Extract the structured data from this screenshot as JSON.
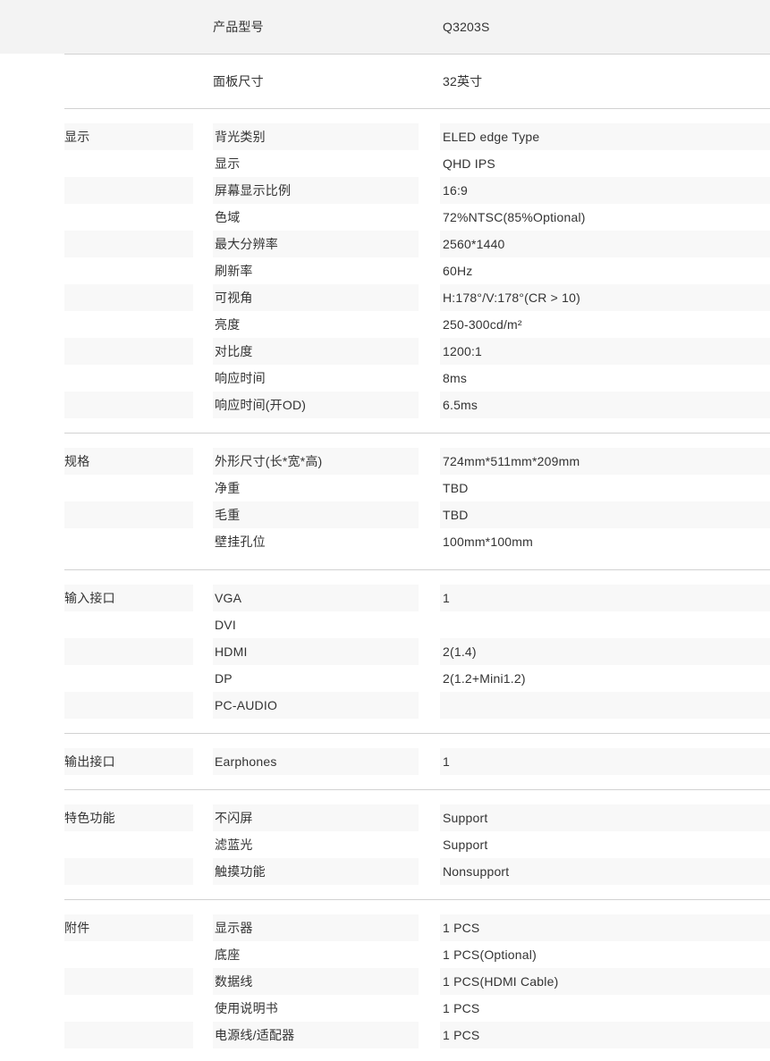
{
  "palette": {
    "page_background": "#ffffff",
    "intro_row_shaded": "#f3f3f3",
    "zebra_band": "#f8f8f8",
    "divider": "#d2d2d2",
    "text": "#333333"
  },
  "intro_rows": [
    {
      "label": "产品型号",
      "value": "Q3203S",
      "shaded": true
    },
    {
      "label": "面板尺寸",
      "value": "32英寸",
      "shaded": false
    }
  ],
  "sections": [
    {
      "category": "显示",
      "rows": [
        {
          "key": "背光类别",
          "value": "ELED edge Type",
          "shaded": true
        },
        {
          "key": "显示",
          "value": "QHD IPS",
          "shaded": false
        },
        {
          "key": "屏幕显示比例",
          "value": "16:9",
          "shaded": true
        },
        {
          "key": "色域",
          "value": "72%NTSC(85%Optional)",
          "shaded": false
        },
        {
          "key": "最大分辨率",
          "value": "2560*1440",
          "shaded": true
        },
        {
          "key": "刷新率",
          "value": "60Hz",
          "shaded": false
        },
        {
          "key": "可视角",
          "value": "H:178°/V:178°(CR > 10)",
          "shaded": true
        },
        {
          "key": "亮度",
          "value": "250-300cd/m²",
          "shaded": false
        },
        {
          "key": "对比度",
          "value": "1200:1",
          "shaded": true
        },
        {
          "key": "响应时间",
          "value": "8ms",
          "shaded": false
        },
        {
          "key": "响应时间(开OD)",
          "value": "6.5ms",
          "shaded": true
        }
      ]
    },
    {
      "category": "规格",
      "rows": [
        {
          "key": "外形尺寸(长*宽*高)",
          "value": "724mm*511mm*209mm",
          "shaded": true
        },
        {
          "key": "净重",
          "value": "TBD",
          "shaded": false
        },
        {
          "key": "毛重",
          "value": "TBD",
          "shaded": true
        },
        {
          "key": "壁挂孔位",
          "value": "100mm*100mm",
          "shaded": false
        }
      ]
    },
    {
      "category": "输入接口",
      "rows": [
        {
          "key": "VGA",
          "value": "1",
          "shaded": true
        },
        {
          "key": "DVI",
          "value": "",
          "shaded": false
        },
        {
          "key": "HDMI",
          "value": "2(1.4)",
          "shaded": true
        },
        {
          "key": "DP",
          "value": "2(1.2+Mini1.2)",
          "shaded": false
        },
        {
          "key": "PC-AUDIO",
          "value": "",
          "shaded": true
        }
      ]
    },
    {
      "category": "输出接口",
      "rows": [
        {
          "key": "Earphones",
          "value": "1",
          "shaded": true
        }
      ]
    },
    {
      "category": "特色功能",
      "rows": [
        {
          "key": "不闪屏",
          "value": "Support",
          "shaded": true
        },
        {
          "key": "滤蓝光",
          "value": "Support",
          "shaded": false
        },
        {
          "key": "触摸功能",
          "value": "Nonsupport",
          "shaded": true
        }
      ]
    },
    {
      "category": "附件",
      "rows": [
        {
          "key": "显示器",
          "value": "1 PCS",
          "shaded": true
        },
        {
          "key": "底座",
          "value": "1 PCS(Optional)",
          "shaded": false
        },
        {
          "key": "数据线",
          "value": "1 PCS(HDMI Cable)",
          "shaded": true
        },
        {
          "key": "使用说明书",
          "value": "1 PCS",
          "shaded": false
        },
        {
          "key": "电源线/适配器",
          "value": "1 PCS",
          "shaded": true
        }
      ]
    }
  ]
}
